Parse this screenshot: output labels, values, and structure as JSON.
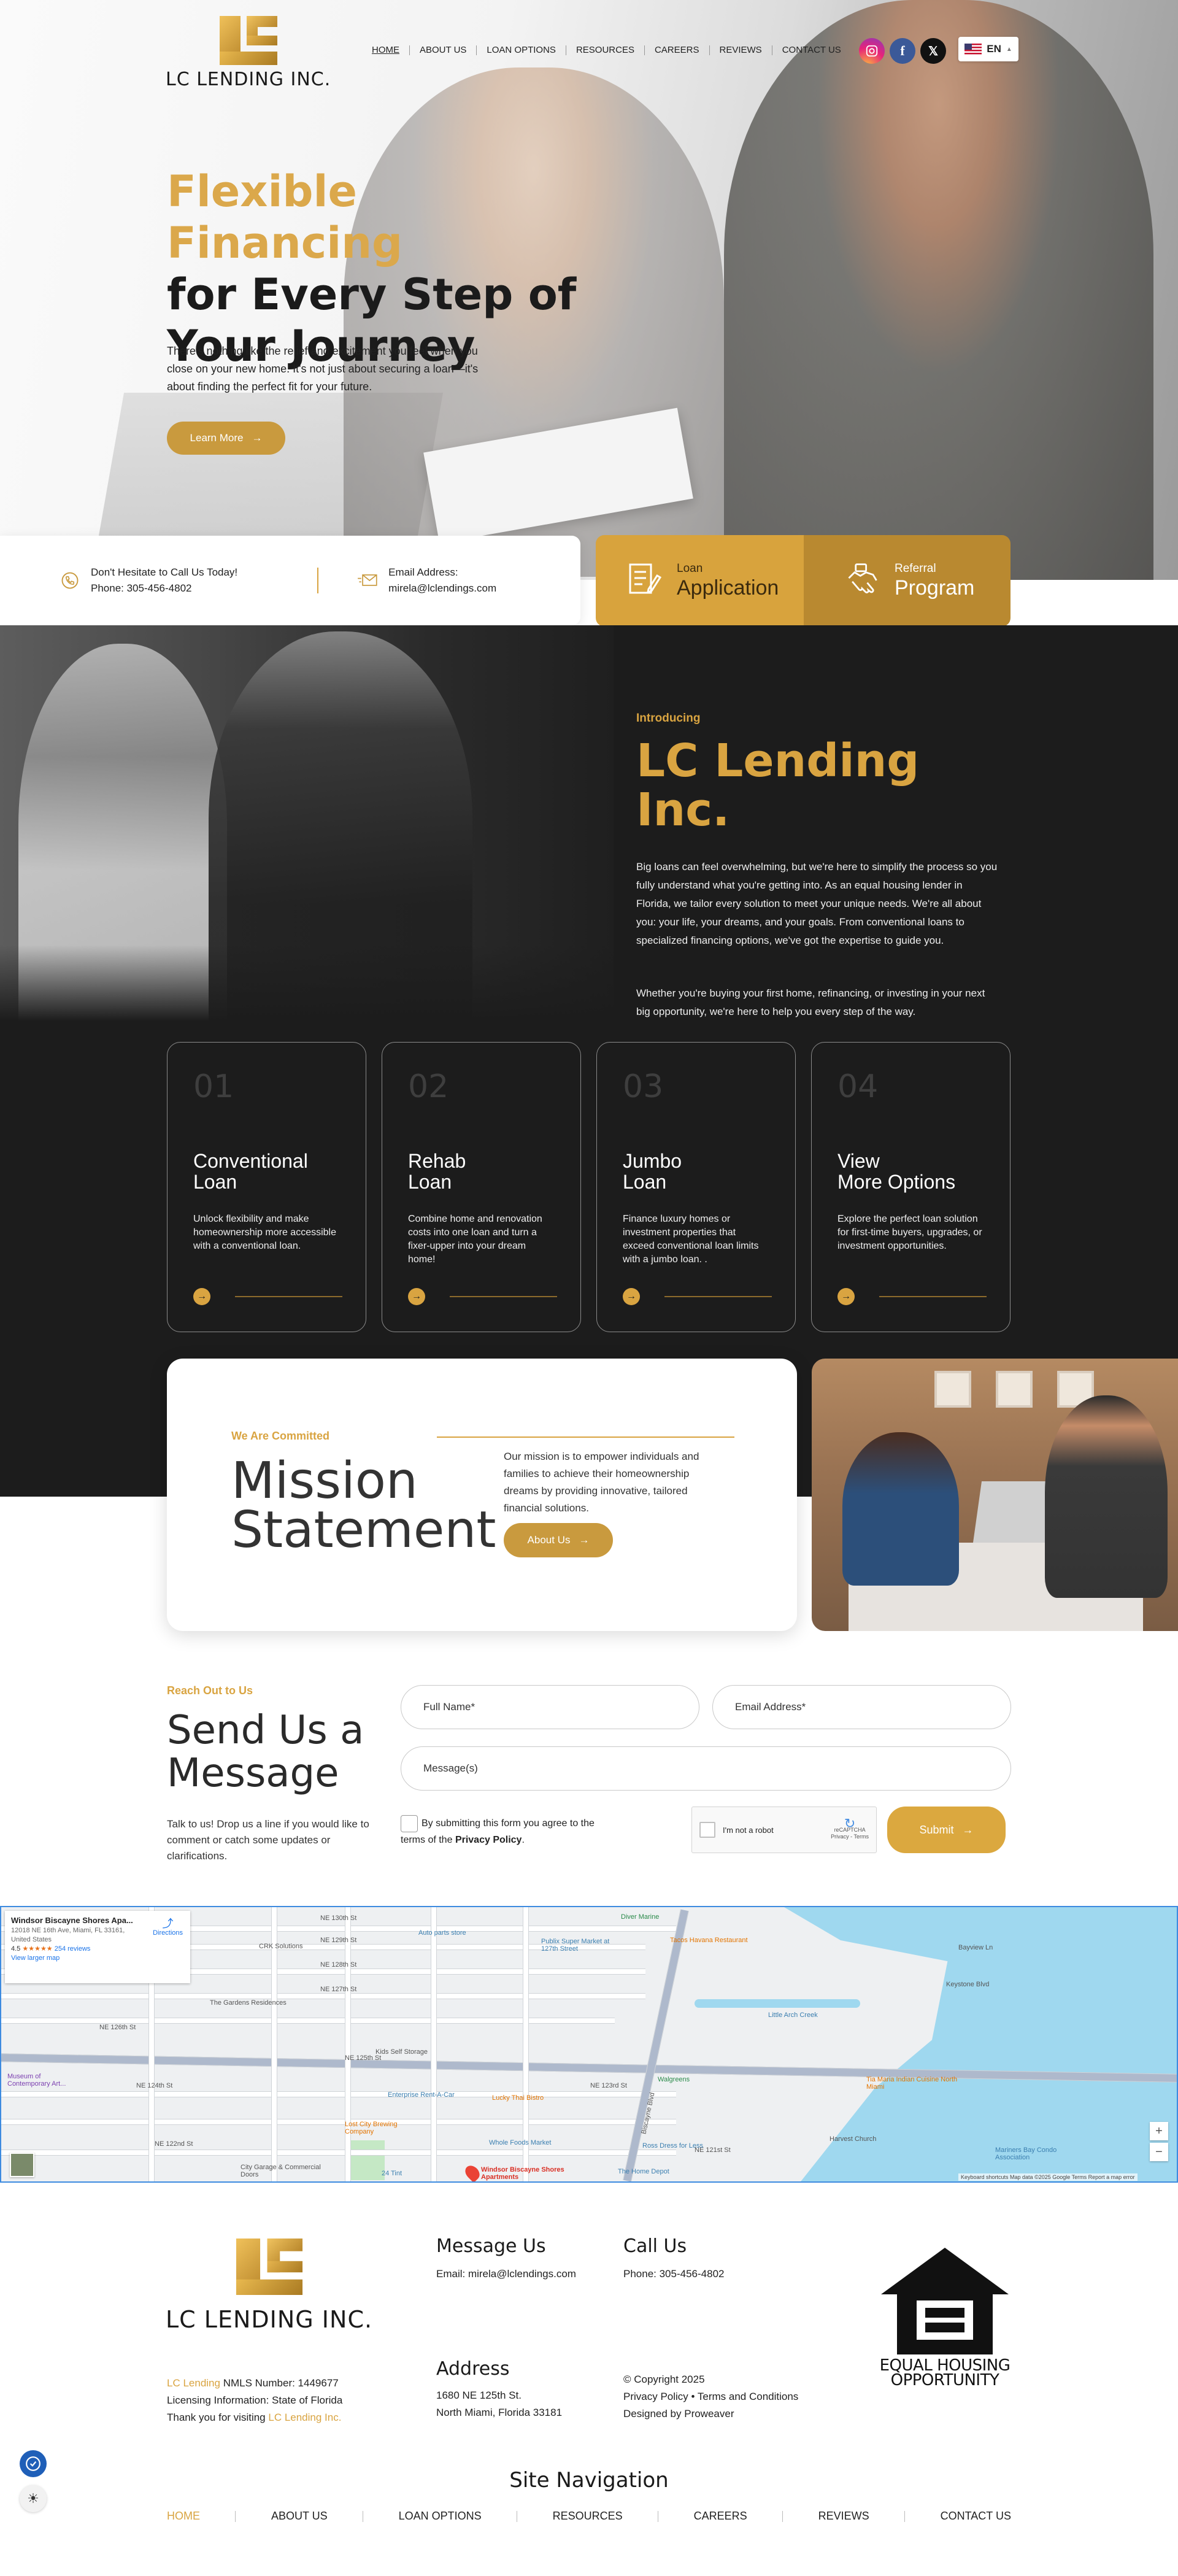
{
  "brand": {
    "logo_text": "LC LENDING INC."
  },
  "nav": {
    "items": [
      "HOME",
      "ABOUT US",
      "LOAN OPTIONS",
      "RESOURCES",
      "CAREERS",
      "REVIEWS",
      "CONTACT US"
    ],
    "language": "EN"
  },
  "hero": {
    "title_line1": "Flexible Financing",
    "title_line2": "for Every Step of",
    "title_line3": "Your Journey",
    "text": "There's nothing like the relief and excitement you feel when you close on your new home. It's not just about securing a loan—it's about finding the perfect fit for your future.",
    "button": "Learn More"
  },
  "contact_strip": {
    "phone_label": "Don't Hesitate to Call Us Today!",
    "phone": "Phone: 305-456-4802",
    "email_label": "Email Address:",
    "email": "mirela@lclendings.com"
  },
  "cta": {
    "loan_small": "Loan",
    "loan_big": "Application",
    "referral_small": "Referral",
    "referral_big": "Program"
  },
  "intro": {
    "label": "Introducing",
    "title": "LC Lending Inc.",
    "p1": "Big loans can feel overwhelming, but we're here to simplify the process so you fully understand what you're getting into. As an equal housing lender in Florida, we tailor every solution to meet your unique needs. We're all about you: your life, your dreams, and your goals. From conventional loans to specialized financing options, we've got the expertise to guide you.",
    "p2": "Whether you're buying your first home, refinancing, or investing in your next big opportunity, we're here to help you every step of the way."
  },
  "cards": [
    {
      "num": "01",
      "title1": "Conventional",
      "title2": "Loan",
      "desc": "Unlock flexibility and make homeownership more accessible with a conventional loan."
    },
    {
      "num": "02",
      "title1": "Rehab",
      "title2": "Loan",
      "desc": "Combine home and renovation costs into one loan and turn a fixer-upper into your dream home!"
    },
    {
      "num": "03",
      "title1": "Jumbo",
      "title2": "Loan",
      "desc": "Finance luxury homes or investment properties that exceed conventional loan limits with a jumbo loan. ."
    },
    {
      "num": "04",
      "title1": "View",
      "title2": "More Options",
      "desc": "Explore the perfect loan solution for first-time buyers, upgrades, or investment opportunities."
    }
  ],
  "mission": {
    "label": "We Are Committed",
    "title1": "Mission",
    "title2": "Statement",
    "text": "Our mission is to empower individuals and families to achieve their homeownership dreams by providing innovative, tailored financial solutions.",
    "button": "About Us"
  },
  "form": {
    "label": "Reach Out to Us",
    "title1": "Send Us a",
    "title2": "Message",
    "text": "Talk to us! Drop us a line if you would like to comment or catch some updates or clarifications.",
    "name_placeholder": "Full Name*",
    "email_placeholder": "Email Address*",
    "message_placeholder": "Message(s)",
    "consent_text": "By submitting this form you agree to the terms of the",
    "consent_link": "Privacy Policy",
    "captcha_label": "I'm not a robot",
    "captcha_brand": "reCAPTCHA",
    "captcha_sub": "Privacy - Terms",
    "submit": "Submit"
  },
  "map": {
    "place_name": "Windsor Biscayne Shores Apa...",
    "address": "12018 NE 16th Ave, Miami, FL 33161, United States",
    "rating": "4.5",
    "stars": "★★★★★",
    "reviews": "254 reviews",
    "larger_map": "View larger map",
    "directions": "Directions",
    "pin_label": "Windsor Biscayne Shores Apartments",
    "streets": [
      "NE 130th St",
      "NE 129th St",
      "NE 128th St",
      "NE 127th St",
      "NE 125th St",
      "NE 124th St",
      "NE 123rd St",
      "NE 122nd St",
      "NE 121st St",
      "NE 126th St",
      "Biscayne Blvd",
      "NE 16th Ave",
      "Little Arch Creek",
      "Bayview Ln",
      "Keystone Blvd",
      "NE 14th Ave"
    ],
    "pois": [
      "Diver Marine",
      "Publix Super Market at 127th Street",
      "Tacos Havana Restaurant",
      "Kids Self Storage",
      "Enterprise Rent-A-Car",
      "Lucky Thai Bistro",
      "Lost City Brewing Company",
      "Whole Foods Market",
      "Ross Dress for Less",
      "The Home Depot",
      "Walgreens",
      "Tia Maria Indian Cuisine North Miami",
      "Harvest Church",
      "Mariners Bay Condo Association",
      "The Gardens Residences",
      "CRK Solutions",
      "Auto parts store",
      "Museum of Contemporary Art...",
      "City Garage & Commercial Doors",
      "24 Tint"
    ],
    "attribution": "Keyboard shortcuts   Map data ©2025 Google   Terms   Report a map error"
  },
  "footer": {
    "message_title": "Message Us",
    "message_email": "Email: mirela@lclendings.com",
    "call_title": "Call Us",
    "call_phone": "Phone: 305-456-4802",
    "address_title": "Address",
    "address_line1": "1680 NE 125th St.",
    "address_line2": "North Miami, Florida 33181",
    "nmls_brand": "LC Lending",
    "nmls_rest": " NMLS Number: 1449677",
    "licensing": "Licensing Information: State of Florida",
    "thanks_prefix": "Thank you for visiting ",
    "thanks_brand": "LC Lending Inc.",
    "copyright": "© Copyright 2025",
    "legal": "Privacy Policy • Terms and Conditions",
    "designed": "Designed by Proweaver",
    "eho_line1": "EQUAL HOUSING",
    "eho_line2": "OPPORTUNITY",
    "site_nav_title": "Site Navigation",
    "site_nav": [
      "HOME",
      "ABOUT US",
      "LOAN OPTIONS",
      "RESOURCES",
      "CAREERS",
      "REVIEWS",
      "CONTACT US"
    ]
  },
  "colors": {
    "gold": "#d9a441",
    "dark": "#1c1c1c"
  }
}
